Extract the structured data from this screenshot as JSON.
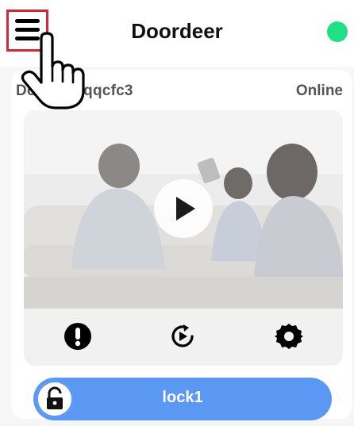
{
  "header": {
    "title": "Doordeer",
    "menu_icon": "hamburger-menu-icon",
    "status_color": "#1fe085"
  },
  "device": {
    "name": "Doorbell-qqcfc3",
    "status": "Online",
    "preview_icon": "play-icon"
  },
  "controls": [
    {
      "icon": "alert-icon"
    },
    {
      "icon": "replay-icon"
    },
    {
      "icon": "settings-icon"
    }
  ],
  "lock": {
    "label": "lock1",
    "icon": "unlocked-padlock-icon",
    "color": "#5b98f3"
  },
  "overlay": {
    "icon": "pointing-hand-icon"
  },
  "colors": {
    "highlight_border": "#d0283b",
    "text_muted": "#555555"
  }
}
